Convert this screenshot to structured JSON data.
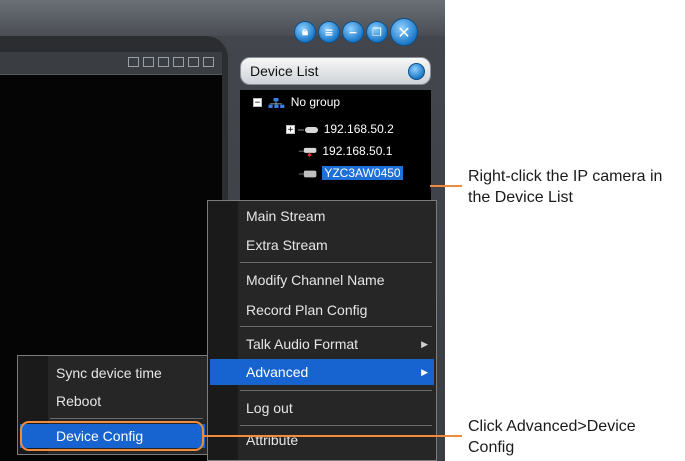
{
  "window_controls": [
    {
      "name": "lock-button",
      "glyph": "🔒︎"
    },
    {
      "name": "list-button",
      "glyph": "≡"
    },
    {
      "name": "minimize-button",
      "glyph": "−"
    },
    {
      "name": "restore-button",
      "glyph": "❐"
    },
    {
      "name": "close-button",
      "glyph": "✕"
    }
  ],
  "device_list": {
    "title": "Device List",
    "group": "No group",
    "devices": [
      "192.168.50.2",
      "192.168.50.1",
      "YZC3AW0450"
    ],
    "selected": "YZC3AW0450"
  },
  "context_menu": {
    "items": [
      "Main Stream",
      "Extra Stream",
      "Modify Channel Name",
      "Record Plan Config",
      "Talk Audio Format",
      "Advanced",
      "Log out",
      "Attribute"
    ],
    "highlighted": "Advanced"
  },
  "submenu": {
    "items": [
      "Sync device time",
      "Reboot",
      "Device Config"
    ],
    "highlighted": "Device Config"
  },
  "annotations": {
    "callout_1": "Right-click the IP camera in the Device List",
    "callout_2": "Click Advanced>Device Config"
  },
  "colors": {
    "accent": "#f08a3c",
    "highlight": "#1763cf"
  }
}
